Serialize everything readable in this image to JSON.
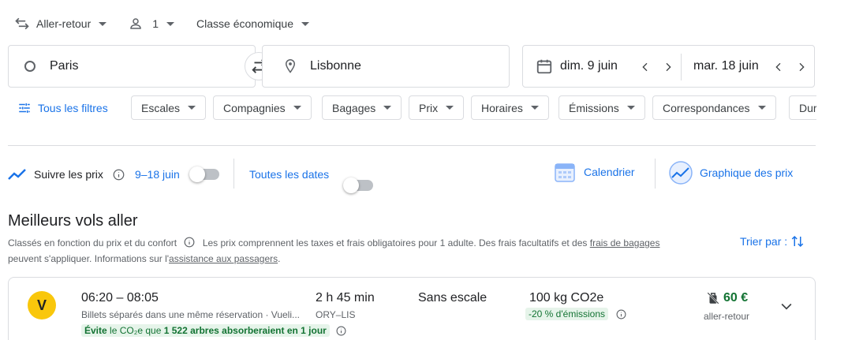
{
  "search_bar": {
    "trip_type": "Aller-retour",
    "passengers": "1",
    "cabin_class": "Classe économique",
    "origin": "Paris",
    "destination": "Lisbonne",
    "depart_date": "dim. 9 juin",
    "return_date": "mar. 18 juin"
  },
  "filters": {
    "all_filters": "Tous les filtres",
    "chips": [
      "Escales",
      "Compagnies",
      "Bagages",
      "Prix",
      "Horaires",
      "Émissions",
      "Correspondances",
      "Dur"
    ]
  },
  "tools": {
    "track_prices": "Suivre les prix",
    "track_dates": "9–18 juin",
    "all_dates": "Toutes les dates",
    "calendar": "Calendrier",
    "price_graph": "Graphique des prix"
  },
  "results": {
    "title": "Meilleurs vols aller",
    "subtitle_part1": "Classés en fonction du prix et du confort",
    "subtitle_part2": "Les prix comprennent les taxes et frais obligatoires pour 1 adulte. Des frais facultatifs et des",
    "bag_fees_link": "frais de bagages",
    "subtitle_line2_part1": "peuvent s'appliquer. Informations sur l'",
    "assistance_link": "assistance aux passagers",
    "subtitle_line2_end": ".",
    "sort_label": "Trier par :"
  },
  "flight": {
    "airline_logo_letter": "V",
    "times": "06:20 – 08:05",
    "details": "Billets séparés dans une même réservation · Vueli...",
    "duration": "2 h 45 min",
    "route": "ORY–LIS",
    "stops": "Sans escale",
    "emissions": "100 kg CO2e",
    "emissions_badge": "-20 % d'émissions",
    "eco_prefix": "Évite",
    "eco_middle": "le CO₂e que",
    "eco_bold": "1 522 arbres absorberaient en 1 jour",
    "price": "60 €",
    "price_type": "aller-retour"
  },
  "colors": {
    "accent": "#1a73e8",
    "green": "#137333",
    "logo_yellow": "#f9c70c"
  }
}
